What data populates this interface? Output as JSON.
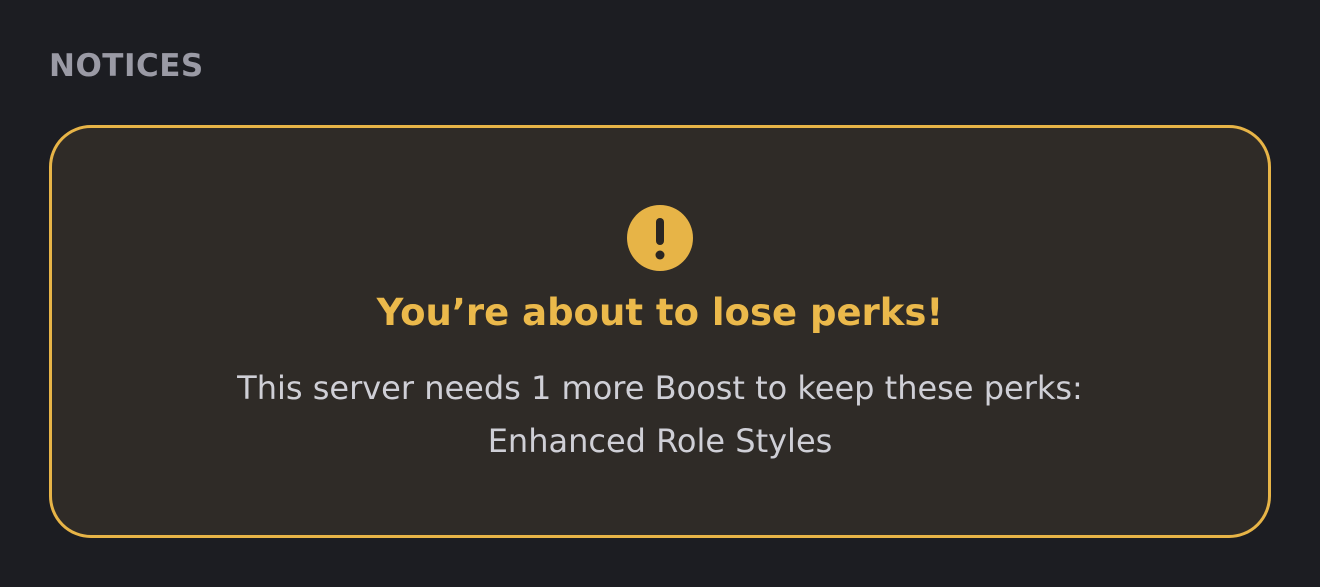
{
  "section": {
    "heading": "NOTICES"
  },
  "notice": {
    "icon": "exclamation-circle-icon",
    "title": "You’re about to lose perks!",
    "message_line1": "This server needs 1 more Boost to keep these perks:",
    "message_line2": "Enhanced Role Styles"
  },
  "colors": {
    "background": "#1c1d22",
    "card_background": "#2f2b27",
    "accent_warning": "#e7b447",
    "heading_text": "#9a9aa5",
    "body_text": "#cfcfd6"
  }
}
